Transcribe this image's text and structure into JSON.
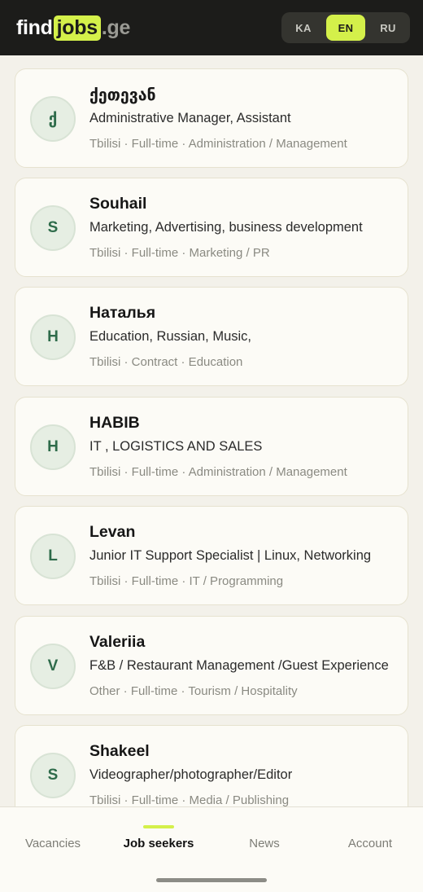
{
  "header": {
    "logo": {
      "find": "find",
      "jobs": "jobs",
      "ge": ".ge"
    },
    "languages": [
      {
        "code": "KA",
        "active": false
      },
      {
        "code": "EN",
        "active": true
      },
      {
        "code": "RU",
        "active": false
      }
    ]
  },
  "seekers": [
    {
      "initial": "ქ",
      "name": "ქეთევან",
      "role": "Administrative Manager, Assistant",
      "meta": "Tbilisi · Full-time · Administration / Management"
    },
    {
      "initial": "S",
      "name": "Souhail",
      "role": "Marketing, Advertising, business development",
      "meta": "Tbilisi · Full-time · Marketing / PR"
    },
    {
      "initial": "Н",
      "name": "Наталья",
      "role": "Education, Russian, Music,",
      "meta": "Tbilisi · Contract · Education"
    },
    {
      "initial": "H",
      "name": "HABIB",
      "role": "IT , LOGISTICS AND SALES",
      "meta": "Tbilisi · Full-time · Administration / Management"
    },
    {
      "initial": "L",
      "name": "Levan",
      "role": "Junior IT Support Specialist | Linux, Networking",
      "meta": "Tbilisi · Full-time · IT / Programming"
    },
    {
      "initial": "V",
      "name": "Valeriia",
      "role": "F&B / Restaurant Management /Guest Experience",
      "meta": "Other · Full-time · Tourism / Hospitality"
    },
    {
      "initial": "S",
      "name": "Shakeel",
      "role": "Videographer/photographer/Editor",
      "meta": "Tbilisi · Full-time · Media / Publishing"
    }
  ],
  "nav": {
    "items": [
      {
        "label": "Vacancies",
        "active": false
      },
      {
        "label": "Job seekers",
        "active": true
      },
      {
        "label": "News",
        "active": false
      },
      {
        "label": "Account",
        "active": false
      }
    ]
  },
  "colors": {
    "accent": "#d4f04a",
    "header_bg": "#1c1c1a",
    "avatar_text": "#2e6b4a"
  }
}
